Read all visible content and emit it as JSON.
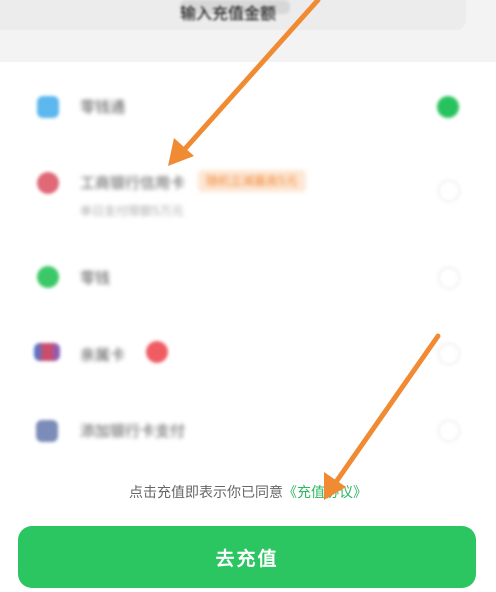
{
  "top": {
    "input_hint": "输入充值金额"
  },
  "payment_methods": [
    {
      "label": "零钱通",
      "sub": "",
      "tag": "",
      "icon": "wallet-icon",
      "color": "#5bb7ee",
      "selected": true
    },
    {
      "label": "工商银行信用卡",
      "sub": "单日支付限额5万元",
      "tag": "随机立减最高5元",
      "icon": "bank-card-icon",
      "color": "#e06877",
      "selected": false
    },
    {
      "label": "零钱",
      "sub": "",
      "tag": "",
      "icon": "change-icon",
      "color": "#3cc867",
      "selected": false
    },
    {
      "label": "亲属卡",
      "sub": "",
      "tag": "",
      "icon": "family-card-icon",
      "color": "#6a7fb6",
      "selected": false
    },
    {
      "label": "添加银行卡支付",
      "sub": "",
      "tag": "",
      "icon": "add-card-icon",
      "color": "#7c8cb8",
      "selected": false
    }
  ],
  "agreement": {
    "prefix": "点击充值即表示你已同意",
    "link": "《充值协议》"
  },
  "recharge_button": {
    "label": "去充值",
    "color": "#2bc561"
  },
  "annotation_color": "#f08a33"
}
